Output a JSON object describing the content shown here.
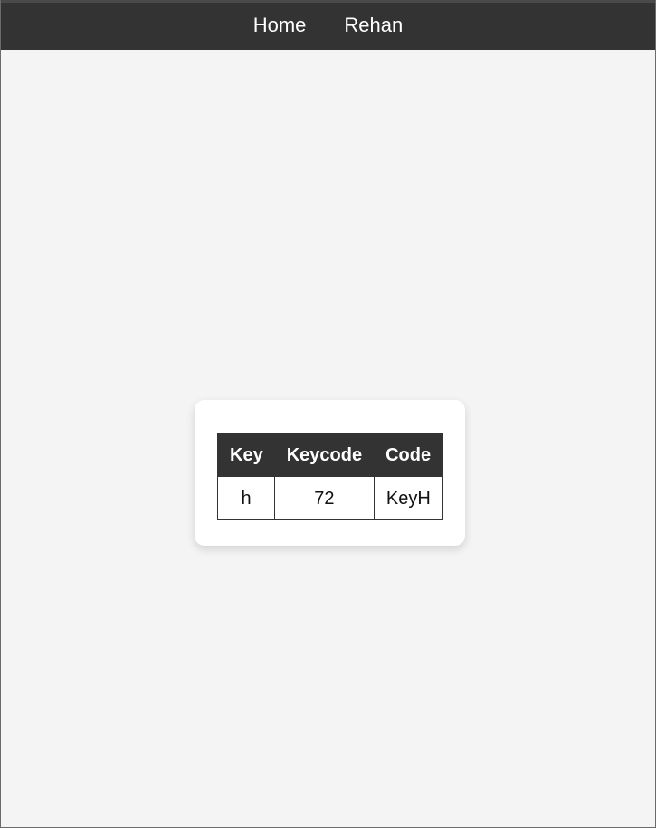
{
  "nav": {
    "links": [
      {
        "label": "Home"
      },
      {
        "label": "Rehan"
      }
    ]
  },
  "key_table": {
    "headers": [
      "Key",
      "Keycode",
      "Code"
    ],
    "rows": [
      [
        "h",
        "72",
        "KeyH"
      ]
    ]
  },
  "colors": {
    "topbar": "#333333",
    "page_background": "#f4f4f4",
    "card_background": "#ffffff",
    "header_background": "#333333",
    "header_text": "#ffffff"
  }
}
